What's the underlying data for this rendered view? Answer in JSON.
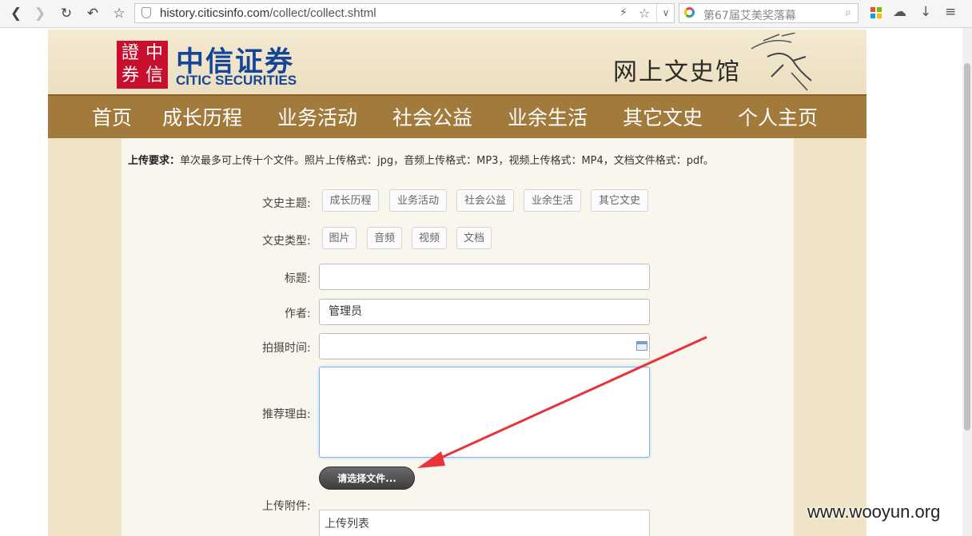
{
  "browser": {
    "url_host": "history.citicsinfo.com",
    "url_path": "/collect/collect.shtml",
    "search_placeholder": "第67届艾美奖落幕"
  },
  "site": {
    "brand_cn": "中信证券",
    "brand_en": "CITIC SECURITIES",
    "seal_chars": [
      "證",
      "中",
      "券",
      "信"
    ],
    "museum_title": "网上文史馆",
    "nav": [
      "首页",
      "成长历程",
      "业务活动",
      "社会公益",
      "业余生活",
      "其它文史",
      "个人主页"
    ]
  },
  "form": {
    "requirement_label": "上传要求：",
    "requirement_text": "单次最多可上传十个文件。照片上传格式：jpg，音频上传格式：MP3，视频上传格式：MP4，文档文件格式：pdf。",
    "theme_label": "文史主题:",
    "themes": [
      "成长历程",
      "业务活动",
      "社会公益",
      "业余生活",
      "其它文史"
    ],
    "type_label": "文史类型:",
    "types": [
      "图片",
      "音频",
      "视频",
      "文档"
    ],
    "title_label": "标题:",
    "title_value": "",
    "author_label": "作者:",
    "author_value": "管理员",
    "time_label": "拍摄时间:",
    "time_value": "",
    "reason_label": "推荐理由:",
    "reason_value": "",
    "file_button": "请选择文件...",
    "attach_label": "上传附件:",
    "upload_list_label": "上传列表"
  },
  "watermark": "www.wooyun.org",
  "colors": {
    "nav_bg": "#a27a3c",
    "brand_blue": "#15459b",
    "seal_red": "#c8102e",
    "annotation_arrow": "#e8333a"
  }
}
